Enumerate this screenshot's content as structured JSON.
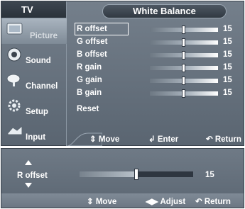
{
  "menu": {
    "title": "TV",
    "items": [
      {
        "label": "Picture",
        "icon": "picture-icon",
        "active": true
      },
      {
        "label": "Sound",
        "icon": "sound-icon",
        "active": false
      },
      {
        "label": "Channel",
        "icon": "channel-icon",
        "active": false
      },
      {
        "label": "Setup",
        "icon": "setup-icon",
        "active": false
      },
      {
        "label": "Input",
        "icon": "input-icon",
        "active": false
      }
    ]
  },
  "panel": {
    "title": "White Balance",
    "settings": [
      {
        "label": "R offset",
        "value": "15",
        "level": 0.5,
        "selected": true
      },
      {
        "label": "G offset",
        "value": "15",
        "level": 0.5,
        "selected": false
      },
      {
        "label": "B offset",
        "value": "15",
        "level": 0.5,
        "selected": false
      },
      {
        "label": "R gain",
        "value": "15",
        "level": 0.5,
        "selected": false
      },
      {
        "label": "G gain",
        "value": "15",
        "level": 0.5,
        "selected": false
      },
      {
        "label": "B gain",
        "value": "15",
        "level": 0.5,
        "selected": false
      },
      {
        "label": "Reset",
        "value": "",
        "level": null,
        "selected": false
      }
    ],
    "footer": {
      "move": "Move",
      "enter": "Enter",
      "return": "Return"
    }
  },
  "adjust": {
    "label": "R offset",
    "value": "15",
    "level": 0.5,
    "footer": {
      "move": "Move",
      "adjust": "Adjust",
      "return": "Return"
    }
  },
  "colors": {
    "panel": "#6a7581",
    "highlight": "#ffffff"
  }
}
